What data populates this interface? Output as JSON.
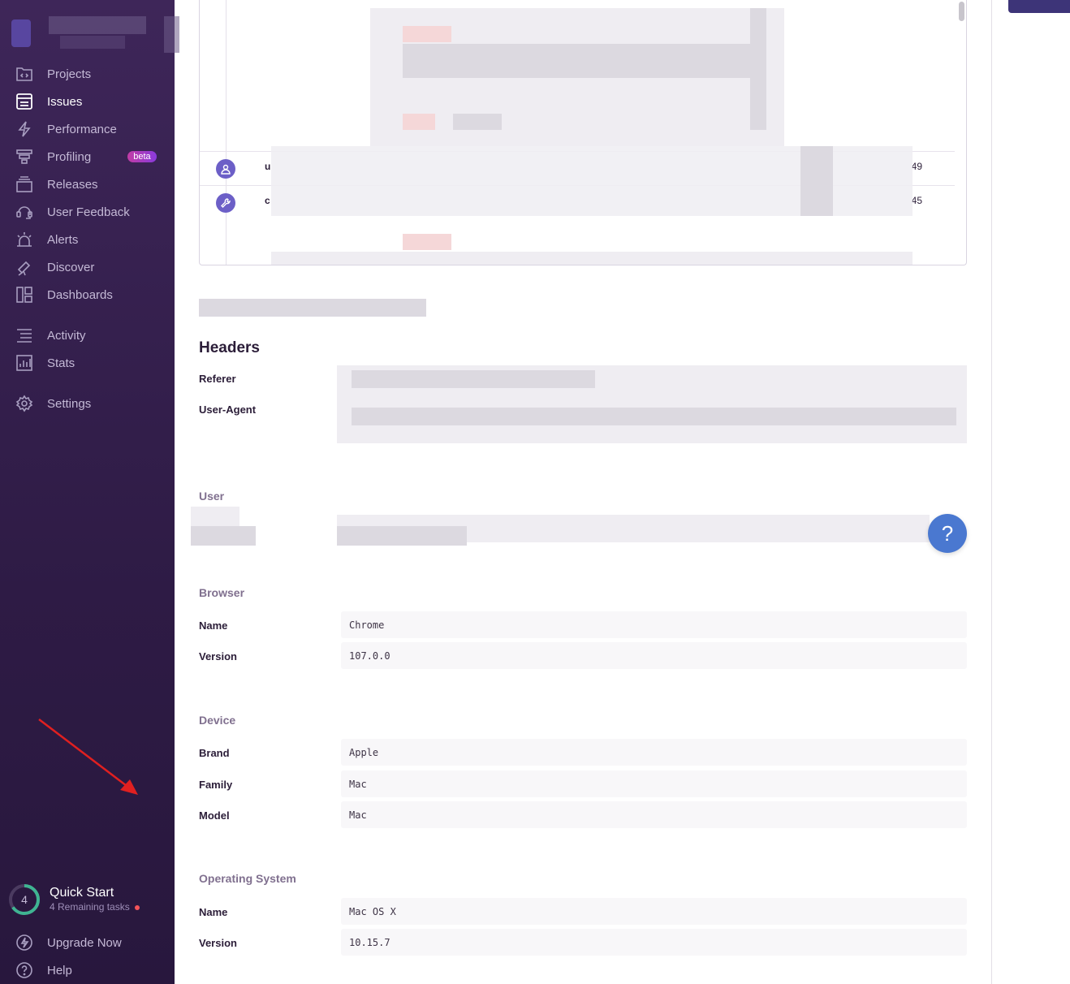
{
  "sidebar": {
    "nav": [
      {
        "label": "Projects",
        "icon": "projects-icon"
      },
      {
        "label": "Issues",
        "icon": "issues-icon",
        "active": true
      },
      {
        "label": "Performance",
        "icon": "performance-icon"
      },
      {
        "label": "Profiling",
        "icon": "profiling-icon",
        "badge": "beta"
      },
      {
        "label": "Releases",
        "icon": "releases-icon"
      },
      {
        "label": "User Feedback",
        "icon": "user-feedback-icon"
      },
      {
        "label": "Alerts",
        "icon": "alerts-icon"
      },
      {
        "label": "Discover",
        "icon": "discover-icon"
      },
      {
        "label": "Dashboards",
        "icon": "dashboards-icon"
      },
      {
        "label": "Activity",
        "icon": "activity-icon"
      },
      {
        "label": "Stats",
        "icon": "stats-icon"
      },
      {
        "label": "Settings",
        "icon": "settings-icon"
      }
    ],
    "quick_start": {
      "count": "4",
      "title": "Quick Start",
      "subtitle": "4 Remaining tasks"
    },
    "footer": [
      {
        "label": "Upgrade Now",
        "icon": "upgrade-icon"
      },
      {
        "label": "Help",
        "icon": "help-icon"
      }
    ]
  },
  "breadcrumbs": {
    "rows": [
      {
        "text": "u",
        "time": "49",
        "icon": "user-icon"
      },
      {
        "text": "c",
        "time": "45",
        "icon": "wrench-icon"
      }
    ]
  },
  "headers": {
    "title": "Headers",
    "keys": [
      "Referer",
      "User-Agent"
    ]
  },
  "user": {
    "title": "User"
  },
  "browser": {
    "title": "Browser",
    "rows": [
      {
        "key": "Name",
        "value": "Chrome"
      },
      {
        "key": "Version",
        "value": "107.0.0"
      }
    ]
  },
  "device": {
    "title": "Device",
    "rows": [
      {
        "key": "Brand",
        "value": "Apple"
      },
      {
        "key": "Family",
        "value": "Mac"
      },
      {
        "key": "Model",
        "value": "Mac"
      }
    ]
  },
  "os": {
    "title": "Operating System",
    "rows": [
      {
        "key": "Name",
        "value": "Mac OS X"
      },
      {
        "key": "Version",
        "value": "10.15.7"
      }
    ]
  },
  "help_button": {
    "label": "?"
  },
  "colors": {
    "sidebar": "#3e2659",
    "accent": "#6c5fc7",
    "help": "#4a78d0",
    "annotation_arrow": "#e02020"
  }
}
